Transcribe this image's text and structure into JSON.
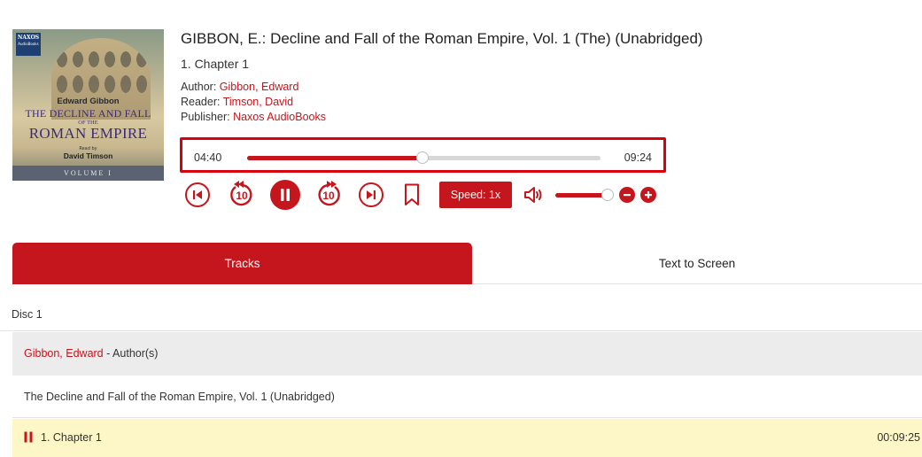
{
  "cover": {
    "publisher_mark": "NAXOS",
    "publisher_mark_sub": "AudioBooks",
    "author": "Edward Gibbon",
    "title_line1": "THE DECLINE AND FALL",
    "title_of": "OF THE",
    "title_line2": "ROMAN EMPIRE",
    "read_by": "Read by",
    "reader": "David Timson",
    "volume": "VOLUME I"
  },
  "album": {
    "title": "GIBBON, E.: Decline and Fall of the Roman Empire, Vol. 1 (The) (Unabridged)",
    "current_track": "1. Chapter 1",
    "author_label": "Author: ",
    "author": "Gibbon, Edward",
    "reader_label": "Reader: ",
    "reader": "Timson, David",
    "publisher_label": "Publisher: ",
    "publisher": "Naxos AudioBooks"
  },
  "player": {
    "current_time": "04:40",
    "total_time": "09:24",
    "progress_fraction": 0.497,
    "seek_back_seconds": "10",
    "seek_forward_seconds": "10",
    "speed_label": "Speed: 1x",
    "volume_fraction": 1.0
  },
  "tabs": [
    {
      "label": "Tracks",
      "active": true
    },
    {
      "label": "Text to Screen",
      "active": false
    }
  ],
  "tracklist": {
    "disc_label": "Disc 1",
    "author_name": "Gibbon, Edward",
    "author_suffix": " - Author(s)",
    "work_title": "The Decline and Fall of the Roman Empire, Vol. 1 (Unabridged)",
    "tracks": [
      {
        "title": "1. Chapter 1",
        "duration": "00:09:25",
        "playing": true
      }
    ]
  },
  "colors": {
    "accent": "#c4161c",
    "highlight_border": "#d8000c",
    "playing_row": "#fdf6c7",
    "author_row": "#ececec"
  }
}
